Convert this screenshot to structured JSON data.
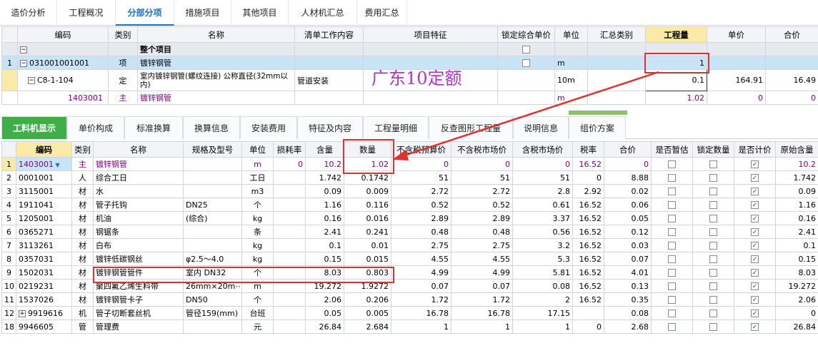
{
  "top_tabs": [
    "造价分析",
    "工程概况",
    "分部分项",
    "措施项目",
    "其他项目",
    "人材机汇总",
    "费用汇总"
  ],
  "top_active": 2,
  "grid1": {
    "headers": [
      "",
      "编码",
      "类别",
      "名称",
      "清单工作内容",
      "项目特征",
      "锁定综合单价",
      "单位",
      "汇总类别",
      "工程量",
      "单价",
      "合价"
    ],
    "rows": [
      {
        "no": "",
        "code": "",
        "type": "",
        "name": "整个项目",
        "work": "",
        "feature": "",
        "unit": "",
        "cat": "",
        "qty": "",
        "price": "",
        "total": ""
      },
      {
        "no": "1",
        "code": "031001001001",
        "type": "项",
        "name": "镀锌钢管",
        "work": "",
        "feature": "",
        "unit": "m",
        "cat": "",
        "qty": "1",
        "price": "",
        "total": ""
      },
      {
        "no": "",
        "code": "C8-1-104",
        "type": "定",
        "name": "室内镀锌钢管(螺纹连接) 公称直径(32mm以内)",
        "work": "管道安装",
        "feature": "",
        "unit": "10m",
        "cat": "",
        "qty": "0.1",
        "price": "164.91",
        "total": "16.49"
      },
      {
        "no": "",
        "code": "1403001",
        "type": "主",
        "name": "镀锌钢管",
        "work": "",
        "feature": "",
        "unit": "m",
        "cat": "",
        "qty": "1.02",
        "price": "0",
        "total": "0"
      }
    ]
  },
  "annotation": "广东10定额",
  "bottom_tabs": [
    "工料机显示",
    "单价构成",
    "标准换算",
    "换算信息",
    "安装费用",
    "特征及内容",
    "工程量明细",
    "反查图形工程量",
    "说明信息",
    "组价方案"
  ],
  "bottom_active": 0,
  "grid2": {
    "headers": [
      "",
      "编码",
      "类别",
      "名称",
      "规格及型号",
      "单位",
      "损耗率",
      "含量",
      "数量",
      "不含税预算价",
      "不含税市场价",
      "含税市场价",
      "税率",
      "合价",
      "是否暂估",
      "锁定数量",
      "是否计价",
      "原始含量"
    ],
    "rows": [
      {
        "no": "1",
        "code": "1403001",
        "type": "主",
        "name": "镀锌钢管",
        "spec": "",
        "unit": "m",
        "loss": "0",
        "content": "10.2",
        "qty": "1.02",
        "p1": "0",
        "p2": "0",
        "p3": "0",
        "tax": "16.52",
        "total": "0",
        "orig": "10.2"
      },
      {
        "no": "2",
        "code": "0001001",
        "type": "人",
        "name": "综合工日",
        "spec": "",
        "unit": "工日",
        "loss": "",
        "content": "1.742",
        "qty": "0.1742",
        "p1": "51",
        "p2": "51",
        "p3": "51",
        "tax": "0",
        "total": "8.88",
        "orig": "1.742"
      },
      {
        "no": "3",
        "code": "3115001",
        "type": "材",
        "name": "水",
        "spec": "",
        "unit": "m3",
        "loss": "",
        "content": "0.09",
        "qty": "0.009",
        "p1": "2.72",
        "p2": "2.72",
        "p3": "2.8",
        "tax": "2.92",
        "total": "0.02",
        "orig": "0.09"
      },
      {
        "no": "4",
        "code": "1911041",
        "type": "材",
        "name": "管子托钩",
        "spec": "DN25",
        "unit": "个",
        "loss": "",
        "content": "1.16",
        "qty": "0.116",
        "p1": "0.52",
        "p2": "0.52",
        "p3": "0.61",
        "tax": "16.52",
        "total": "0.06",
        "orig": "1.16"
      },
      {
        "no": "5",
        "code": "1205001",
        "type": "材",
        "name": "机油",
        "spec": "(综合)",
        "unit": "kg",
        "loss": "",
        "content": "0.16",
        "qty": "0.016",
        "p1": "2.89",
        "p2": "2.89",
        "p3": "3.37",
        "tax": "16.52",
        "total": "0.05",
        "orig": "0.16"
      },
      {
        "no": "6",
        "code": "0365271",
        "type": "材",
        "name": "钢锯条",
        "spec": "",
        "unit": "条",
        "loss": "",
        "content": "2.41",
        "qty": "0.241",
        "p1": "0.48",
        "p2": "0.48",
        "p3": "0.56",
        "tax": "16.52",
        "total": "0.12",
        "orig": "2.41"
      },
      {
        "no": "7",
        "code": "3113261",
        "type": "材",
        "name": "白布",
        "spec": "",
        "unit": "kg",
        "loss": "",
        "content": "0.1",
        "qty": "0.01",
        "p1": "2.75",
        "p2": "2.75",
        "p3": "3.2",
        "tax": "16.52",
        "total": "0.03",
        "orig": "0.1"
      },
      {
        "no": "8",
        "code": "0357031",
        "type": "材",
        "name": "镀锌低碳钢丝",
        "spec": "φ2.5～4.0",
        "unit": "kg",
        "loss": "",
        "content": "0.15",
        "qty": "0.015",
        "p1": "4.55",
        "p2": "4.55",
        "p3": "5.3",
        "tax": "16.52",
        "total": "0.07",
        "orig": "0.15"
      },
      {
        "no": "9",
        "code": "1502031",
        "type": "材",
        "name": "镀锌钢管管件",
        "spec": "室内 DN32",
        "unit": "个",
        "loss": "",
        "content": "8.03",
        "qty": "0.803",
        "p1": "4.99",
        "p2": "4.99",
        "p3": "5.81",
        "tax": "16.52",
        "total": "4.01",
        "orig": "8.03"
      },
      {
        "no": "10",
        "code": "0219231",
        "type": "材",
        "name": "聚四氟乙烯生料带",
        "spec": "26mm×20m⋯",
        "unit": "m",
        "loss": "",
        "content": "19.272",
        "qty": "1.9272",
        "p1": "0.07",
        "p2": "0.07",
        "p3": "0.08",
        "tax": "16.52",
        "total": "0.13",
        "orig": "19.272"
      },
      {
        "no": "11",
        "code": "1537026",
        "type": "材",
        "name": "镀锌钢管卡子",
        "spec": "DN50",
        "unit": "个",
        "loss": "",
        "content": "2.06",
        "qty": "0.206",
        "p1": "1.72",
        "p2": "1.72",
        "p3": "2",
        "tax": "16.52",
        "total": "0.35",
        "orig": "2.06"
      },
      {
        "no": "12",
        "code": "9919616",
        "type": "机",
        "name": "管子切断套丝机",
        "spec": "管径159(mm)",
        "unit": "台班",
        "loss": "",
        "content": "0.05",
        "qty": "0.005",
        "p1": "16.78",
        "p2": "16.78",
        "p3": "17.15",
        "tax": "",
        "total": "0.08",
        "orig": "0"
      },
      {
        "no": "18",
        "code": "9946605",
        "type": "管",
        "name": "管理费",
        "spec": "",
        "unit": "元",
        "loss": "",
        "content": "26.84",
        "qty": "2.684",
        "p1": "1",
        "p2": "1",
        "p3": "1",
        "tax": "0",
        "total": "2.68",
        "orig": "26.84"
      }
    ]
  }
}
